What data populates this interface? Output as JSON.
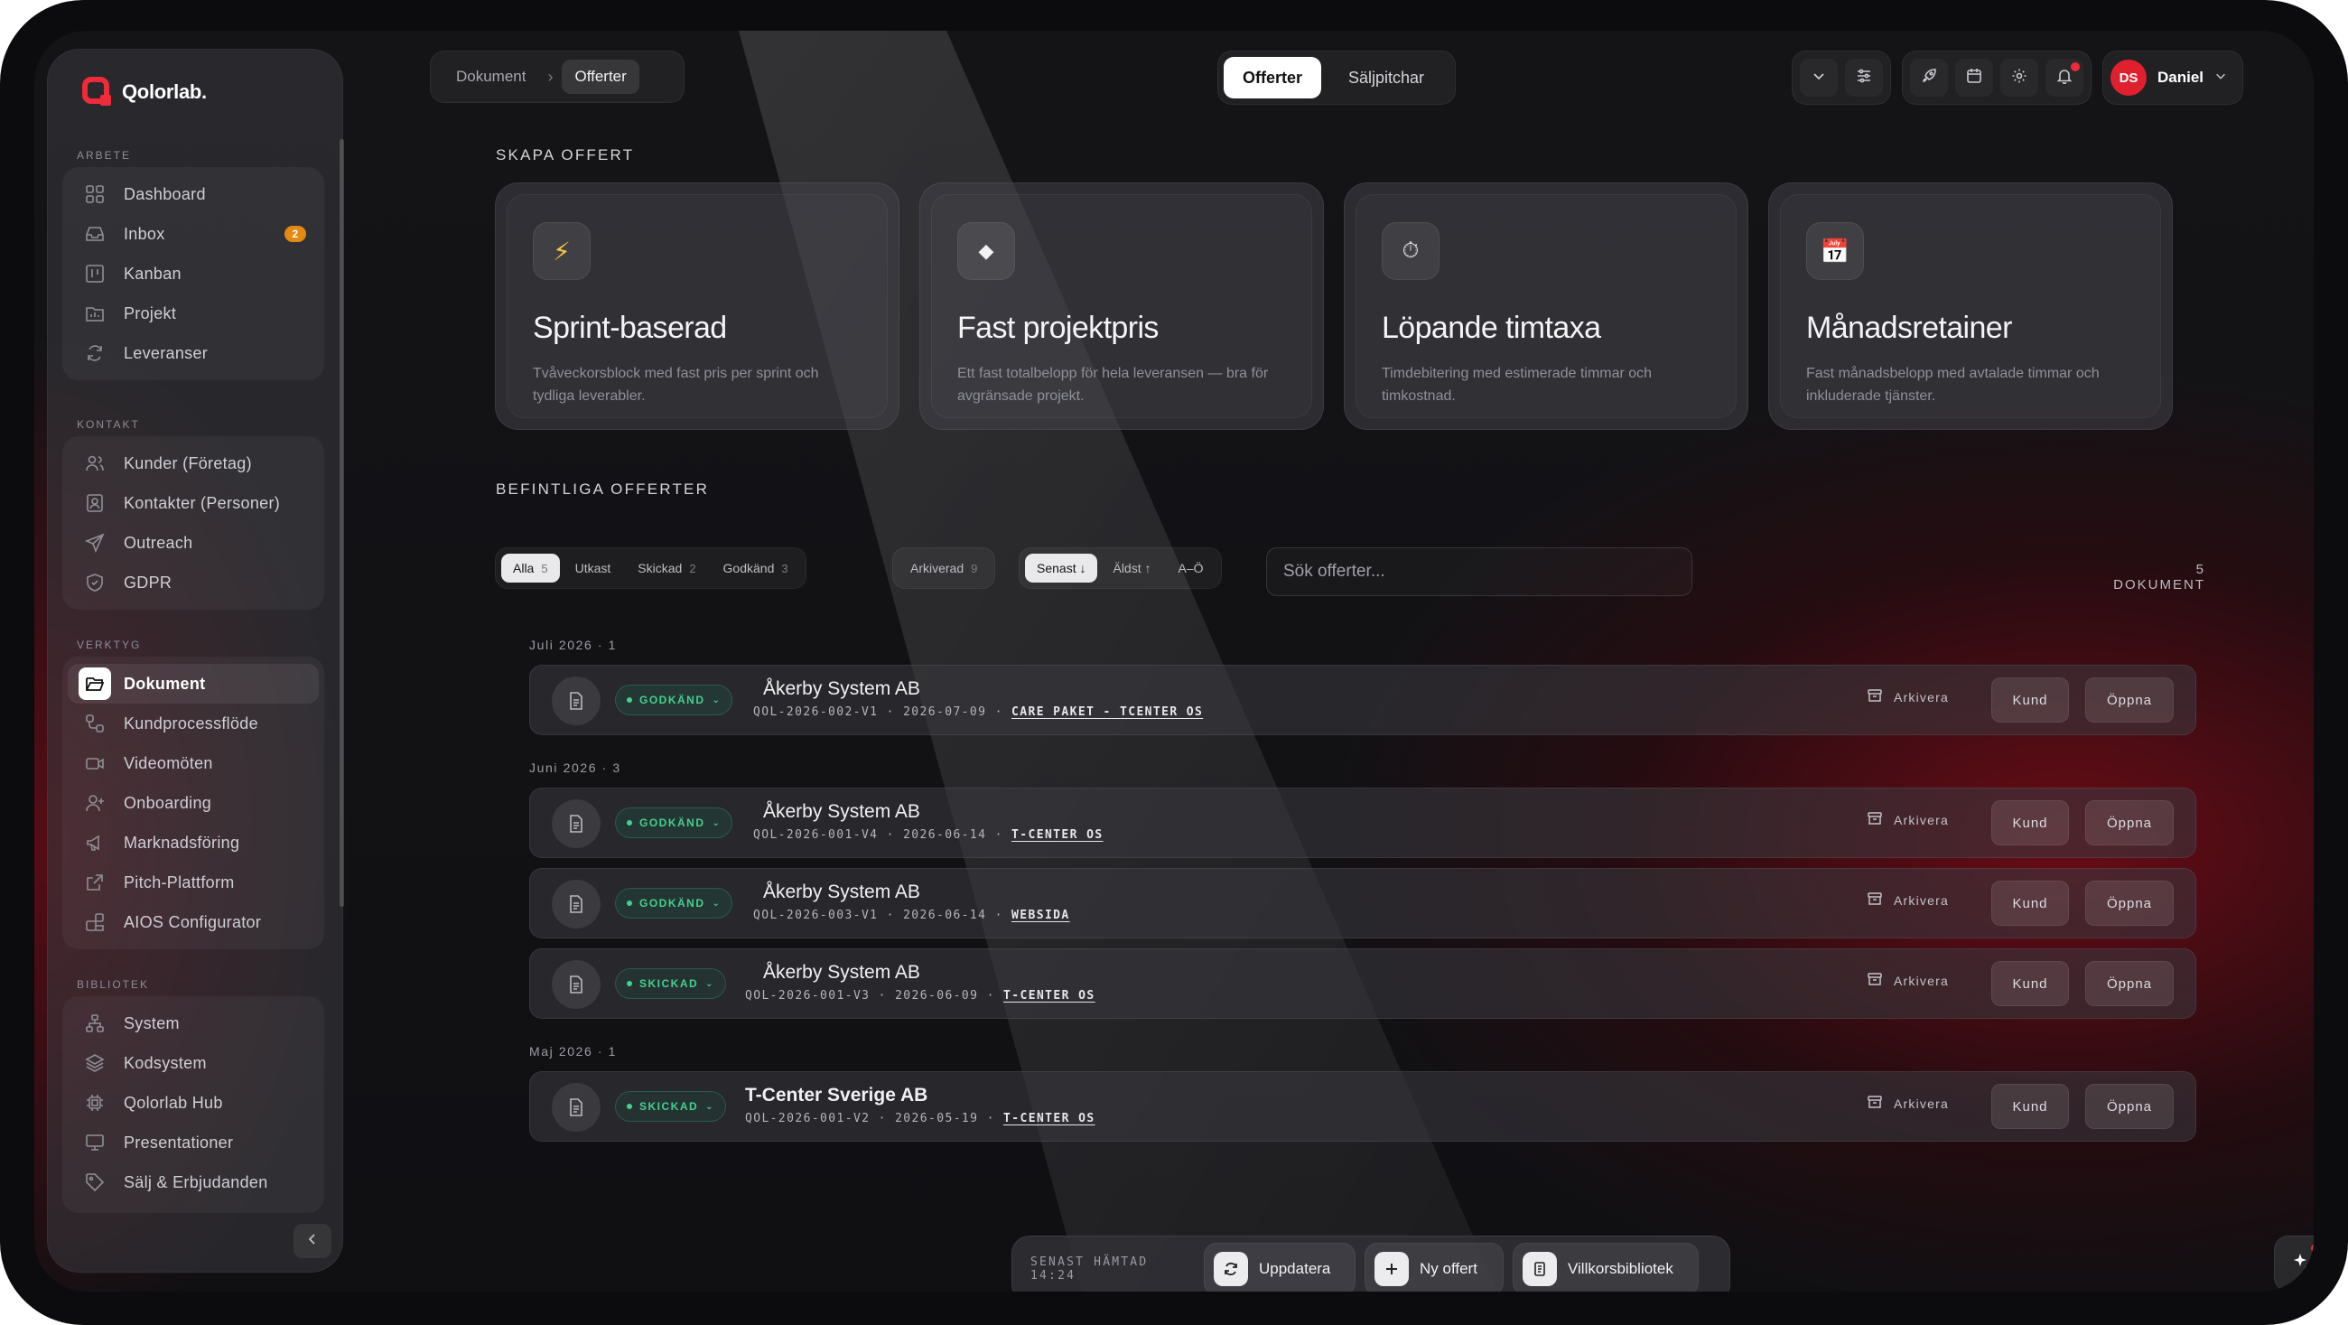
{
  "app": {
    "logo_text": "Qolorlab."
  },
  "sidebar": {
    "sections": [
      {
        "label": "ARBETE",
        "items": [
          {
            "label": "Dashboard",
            "icon": "dashboard-icon"
          },
          {
            "label": "Inbox",
            "icon": "inbox-icon",
            "badge": "2"
          },
          {
            "label": "Kanban",
            "icon": "kanban-icon"
          },
          {
            "label": "Projekt",
            "icon": "folder-icon"
          },
          {
            "label": "Leveranser",
            "icon": "refresh-icon"
          }
        ]
      },
      {
        "label": "KONTAKT",
        "items": [
          {
            "label": "Kunder (Företag)",
            "icon": "users-icon"
          },
          {
            "label": "Kontakter (Personer)",
            "icon": "contact-card-icon"
          },
          {
            "label": "Outreach",
            "icon": "send-icon"
          },
          {
            "label": "GDPR",
            "icon": "shield-icon"
          }
        ]
      },
      {
        "label": "VERKTYG",
        "items": [
          {
            "label": "Dokument",
            "icon": "folder-open-icon",
            "active": true
          },
          {
            "label": "Kundprocessflöde",
            "icon": "flow-icon"
          },
          {
            "label": "Videomöten",
            "icon": "video-icon"
          },
          {
            "label": "Onboarding",
            "icon": "user-plus-icon"
          },
          {
            "label": "Marknadsföring",
            "icon": "megaphone-icon"
          },
          {
            "label": "Pitch-Plattform",
            "icon": "external-link-icon"
          },
          {
            "label": "AIOS Configurator",
            "icon": "blocks-icon"
          }
        ]
      },
      {
        "label": "BIBLIOTEK",
        "items": [
          {
            "label": "System",
            "icon": "network-icon"
          },
          {
            "label": "Kodsystem",
            "icon": "layers-icon"
          },
          {
            "label": "Qolorlab Hub",
            "icon": "chip-icon"
          },
          {
            "label": "Presentationer",
            "icon": "presentation-icon"
          },
          {
            "label": "Sälj & Erbjudanden",
            "icon": "tag-icon"
          }
        ]
      }
    ]
  },
  "breadcrumb": {
    "items": [
      "Dokument",
      "Offerter"
    ]
  },
  "mode_tabs": [
    {
      "label": "Offerter",
      "active": true
    },
    {
      "label": "Säljpitchar",
      "active": false
    }
  ],
  "user": {
    "initials": "DS",
    "name": "Daniel"
  },
  "create": {
    "heading": "SKAPA OFFERT",
    "cards": [
      {
        "icon": "⚡",
        "title": "Sprint-baserad",
        "desc": "Tvåveckorsblock med fast pris per sprint och tydliga leverabler."
      },
      {
        "icon": "◆",
        "title": "Fast projektpris",
        "desc": "Ett fast totalbelopp för hela leveransen — bra för avgränsade projekt."
      },
      {
        "icon": "⏱",
        "title": "Löpande timtaxa",
        "desc": "Timdebitering med estimerade timmar och timkostnad."
      },
      {
        "icon": "📅",
        "title": "Månadsretainer",
        "desc": "Fast månadsbelopp med avtalade timmar och inkluderade tjänster."
      }
    ]
  },
  "existing": {
    "heading": "BEFINTLIGA OFFERTER",
    "status_filters": [
      {
        "label": "Alla",
        "count": "5",
        "active": true
      },
      {
        "label": "Utkast",
        "count": ""
      },
      {
        "label": "Skickad",
        "count": "2"
      },
      {
        "label": "Godkänd",
        "count": "3"
      }
    ],
    "archived_filter": {
      "label": "Arkiverad",
      "count": "9"
    },
    "sort_options": [
      {
        "label": "Senast ↓",
        "active": true
      },
      {
        "label": "Äldst ↑"
      },
      {
        "label": "A–Ö"
      }
    ],
    "search_placeholder": "Sök offerter...",
    "doc_count": "5 DOKUMENT",
    "groups": [
      {
        "label": "Juli 2026 · 1",
        "rows": [
          {
            "status": "GODKÄND",
            "title": "Åkerby System AB",
            "meta": "QOL-2026-002-V1 · 2026-07-09 ·",
            "tag": "CARE PAKET - TCENTER OS",
            "bold": false
          }
        ]
      },
      {
        "label": "Juni 2026 · 3",
        "rows": [
          {
            "status": "GODKÄND",
            "title": "Åkerby System AB",
            "meta": "QOL-2026-001-V4 · 2026-06-14 ·",
            "tag": "T-CENTER OS",
            "bold": false
          },
          {
            "status": "GODKÄND",
            "title": "Åkerby System AB",
            "meta": "QOL-2026-003-V1 · 2026-06-14 ·",
            "tag": "WEBSIDA",
            "bold": false
          },
          {
            "status": "SKICKAD",
            "title": "Åkerby System AB",
            "meta": "QOL-2026-001-V3 · 2026-06-09 ·",
            "tag": "T-CENTER OS",
            "bold": false
          }
        ]
      },
      {
        "label": "Maj 2026 · 1",
        "rows": [
          {
            "status": "SKICKAD",
            "title": "T-Center Sverige AB",
            "meta": "QOL-2026-001-V2 · 2026-05-19 ·",
            "tag": "T-CENTER OS",
            "bold": true
          }
        ]
      }
    ],
    "row_actions": {
      "archive": "Arkivera",
      "customer": "Kund",
      "open": "Öppna"
    }
  },
  "bottom_bar": {
    "last_fetched": "SENAST HÄMTAD 14:24",
    "refresh": "Uppdatera",
    "new_offer": "Ny offert",
    "terms_library": "Villkorsbibliotek"
  },
  "colors": {
    "accent_red": "#e0202e",
    "status_green": "#44d18f",
    "badge_orange": "#e48a12"
  }
}
